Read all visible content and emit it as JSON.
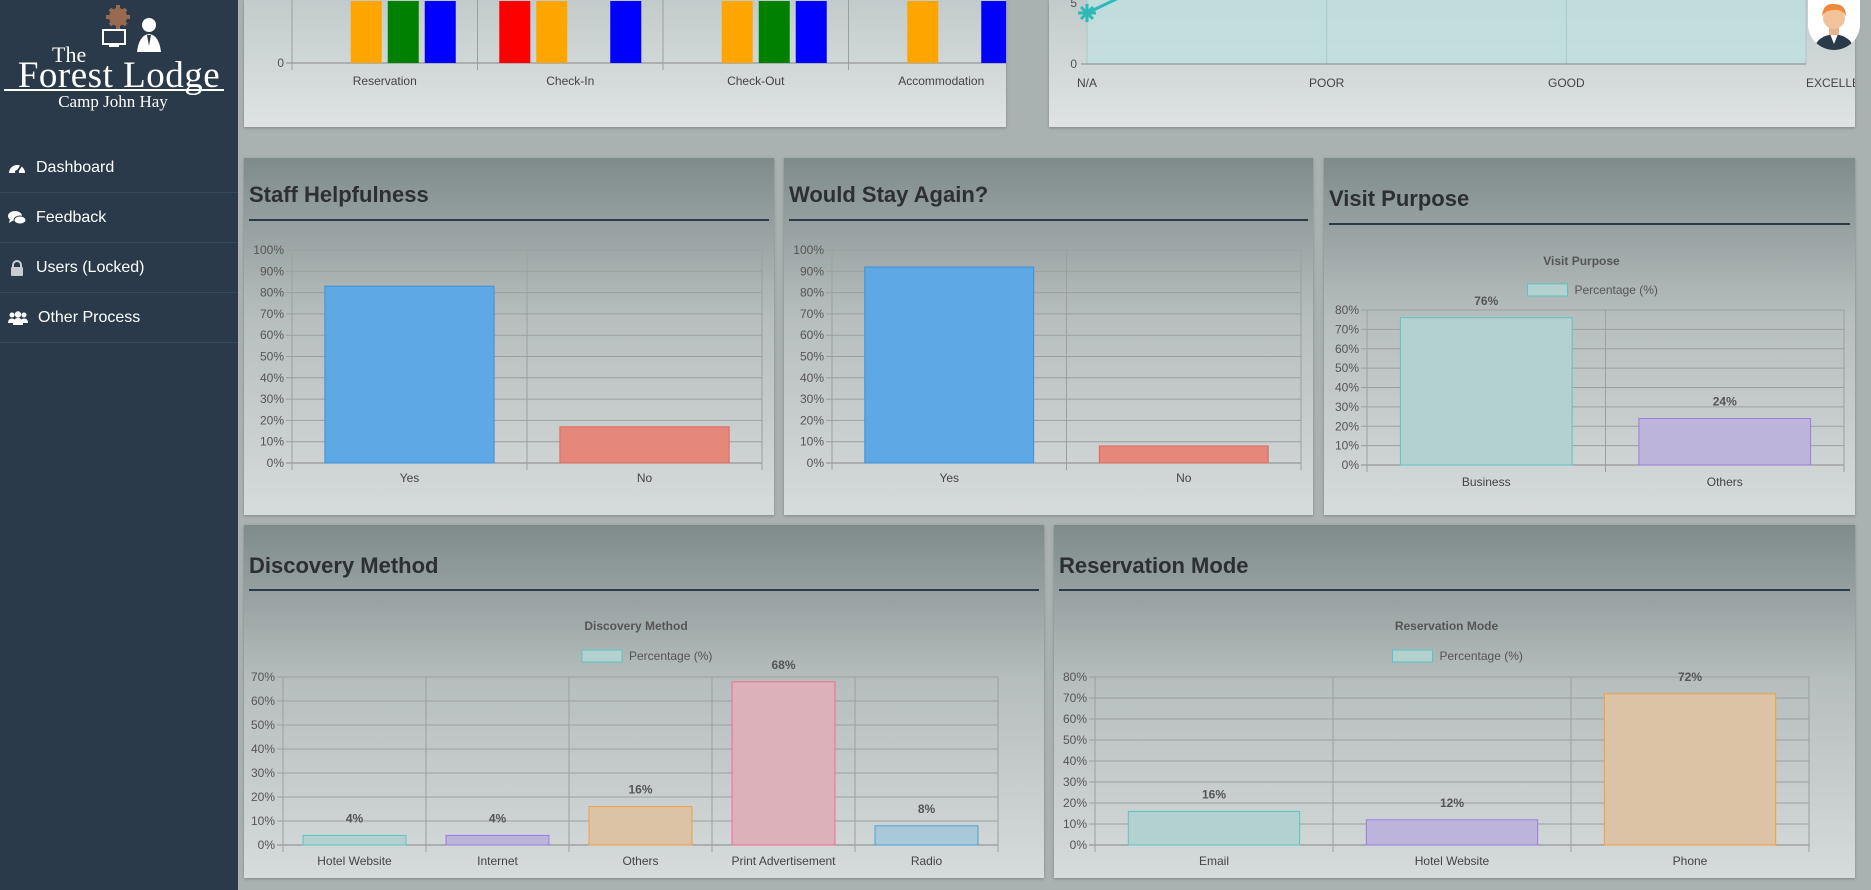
{
  "brand": {
    "the": "The",
    "name": "Forest Lodge",
    "subtitle": "Camp John Hay"
  },
  "nav": [
    {
      "label": "Dashboard",
      "icon": "gauge-icon"
    },
    {
      "label": "Feedback",
      "icon": "comments-icon"
    },
    {
      "label": "Users (Locked)",
      "icon": "lock-icon"
    },
    {
      "label": "Other Process",
      "icon": "users-icon"
    }
  ],
  "panels": {
    "staff": {
      "title": "Staff Helpfulness"
    },
    "stay": {
      "title": "Would Stay Again?"
    },
    "visit": {
      "title": "Visit Purpose"
    },
    "discovery": {
      "title": "Discovery Method"
    },
    "reservation": {
      "title": "Reservation Mode"
    }
  },
  "chart_data": [
    {
      "id": "ratings-by-stage",
      "type": "bar",
      "categories": [
        "Reservation",
        "Check-In",
        "Check-Out",
        "Accommodation"
      ],
      "colors": [
        "#ff0000",
        "#ffa500",
        "#008000",
        "#0000ff"
      ],
      "series": [
        {
          "values": [
            0,
            1,
            0,
            0
          ]
        },
        {
          "values": [
            1,
            1,
            1,
            1
          ]
        },
        {
          "values": [
            1,
            0,
            1,
            0
          ]
        },
        {
          "values": [
            1,
            1,
            1,
            1
          ]
        }
      ],
      "ytick_labels": [
        "0"
      ]
    },
    {
      "id": "rating-line",
      "type": "line",
      "categories": [
        "N/A",
        "POOR",
        "GOOD",
        "EXCELLENT"
      ],
      "ytick_labels": [
        "0",
        "5"
      ],
      "point_value": 5,
      "color": "#2fb8b8"
    },
    {
      "id": "staff-helpfulness",
      "type": "bar",
      "categories": [
        "Yes",
        "No"
      ],
      "values": [
        83,
        17
      ],
      "ylim": [
        0,
        100
      ],
      "ytick_labels": [
        "0%",
        "10%",
        "20%",
        "30%",
        "40%",
        "50%",
        "60%",
        "70%",
        "80%",
        "90%",
        "100%"
      ],
      "colors": [
        "#5fa8e6",
        "#e5877b"
      ],
      "borders": [
        "#3c8fd6",
        "#d86a5e"
      ]
    },
    {
      "id": "would-stay-again",
      "type": "bar",
      "categories": [
        "Yes",
        "No"
      ],
      "values": [
        92,
        8
      ],
      "ylim": [
        0,
        100
      ],
      "ytick_labels": [
        "0%",
        "10%",
        "20%",
        "30%",
        "40%",
        "50%",
        "60%",
        "70%",
        "80%",
        "90%",
        "100%"
      ],
      "colors": [
        "#5fa8e6",
        "#e5877b"
      ],
      "borders": [
        "#3c8fd6",
        "#d86a5e"
      ]
    },
    {
      "id": "visit-purpose",
      "type": "bar",
      "title": "Visit Purpose",
      "legend": "Percentage (%)",
      "categories": [
        "Business",
        "Others"
      ],
      "values": [
        76,
        24
      ],
      "data_labels": [
        "76%",
        "24%"
      ],
      "ylim": [
        0,
        80
      ],
      "ytick_labels": [
        "0%",
        "10%",
        "20%",
        "30%",
        "40%",
        "50%",
        "60%",
        "70%",
        "80%"
      ],
      "colors": [
        "#b3d2cf",
        "#bdb4dc"
      ],
      "borders": [
        "#5cc4c4",
        "#9b7de0"
      ]
    },
    {
      "id": "discovery-method",
      "type": "bar",
      "title": "Discovery Method",
      "legend": "Percentage (%)",
      "categories": [
        "Hotel Website",
        "Internet",
        "Others",
        "Print Advertisement",
        "Radio"
      ],
      "values": [
        4,
        4,
        16,
        68,
        8
      ],
      "data_labels": [
        "4%",
        "4%",
        "16%",
        "68%",
        "8%"
      ],
      "ylim": [
        0,
        70
      ],
      "ytick_labels": [
        "0%",
        "10%",
        "20%",
        "30%",
        "40%",
        "50%",
        "60%",
        "70%"
      ],
      "colors": [
        "#b3d2cf",
        "#bdb4dc",
        "#dcc3a6",
        "#dcb1b9",
        "#a9c8d8"
      ],
      "borders": [
        "#5cc4c4",
        "#9b7de0",
        "#f0a040",
        "#f07088",
        "#4ca0d8"
      ]
    },
    {
      "id": "reservation-mode",
      "type": "bar",
      "title": "Reservation Mode",
      "legend": "Percentage (%)",
      "categories": [
        "Email",
        "Hotel Website",
        "Phone"
      ],
      "values": [
        16,
        12,
        72
      ],
      "data_labels": [
        "16%",
        "12%",
        "72%"
      ],
      "ylim": [
        0,
        80
      ],
      "ytick_labels": [
        "0%",
        "10%",
        "20%",
        "30%",
        "40%",
        "50%",
        "60%",
        "70%",
        "80%"
      ],
      "colors": [
        "#b3d2cf",
        "#bdb4dc",
        "#dcc3a6"
      ],
      "borders": [
        "#5cc4c4",
        "#9b7de0",
        "#f0a040"
      ]
    }
  ]
}
